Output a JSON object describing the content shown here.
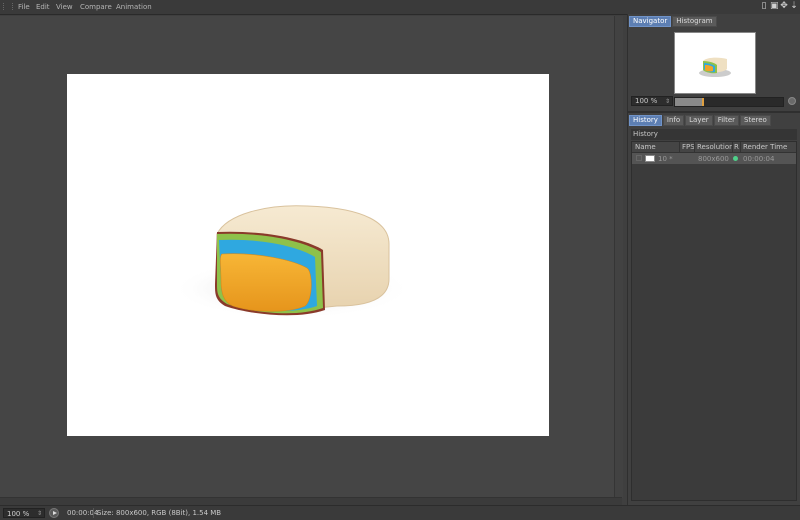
{
  "menu": {
    "items": [
      "File",
      "Edit",
      "View",
      "Compare",
      "Animation"
    ]
  },
  "top_icons": [
    "layout-icon",
    "save-icon",
    "move-icon",
    "pin-icon"
  ],
  "status": {
    "zoom": "100 %",
    "time": "00:00:04",
    "info": "Size: 800x600, RGB (8Bit), 1.54 MB"
  },
  "navigator": {
    "tabs": [
      "Navigator",
      "Histogram"
    ],
    "active_tab": "Navigator",
    "zoom": "100 %",
    "slider_fraction": 0.25
  },
  "history_panel": {
    "tabs": [
      "History",
      "Info",
      "Layer",
      "Filter",
      "Stereo"
    ],
    "active_tab": "History",
    "section_title": "History",
    "columns": [
      "Name",
      "FPS",
      "Resolution",
      "R",
      "Render Time"
    ],
    "rows": [
      {
        "name": "10 *",
        "fps": "",
        "resolution": "800x600",
        "r": "",
        "render_time": "00:00:04"
      }
    ]
  },
  "colors": {
    "active_tab": "#5d7fb3",
    "render_ok": "#4fd08a",
    "bar_orange": "#f0a429",
    "bar_blue": "#2fa8e0",
    "bar_green": "#8ec14a",
    "body_cream": "#f1e3c6"
  }
}
